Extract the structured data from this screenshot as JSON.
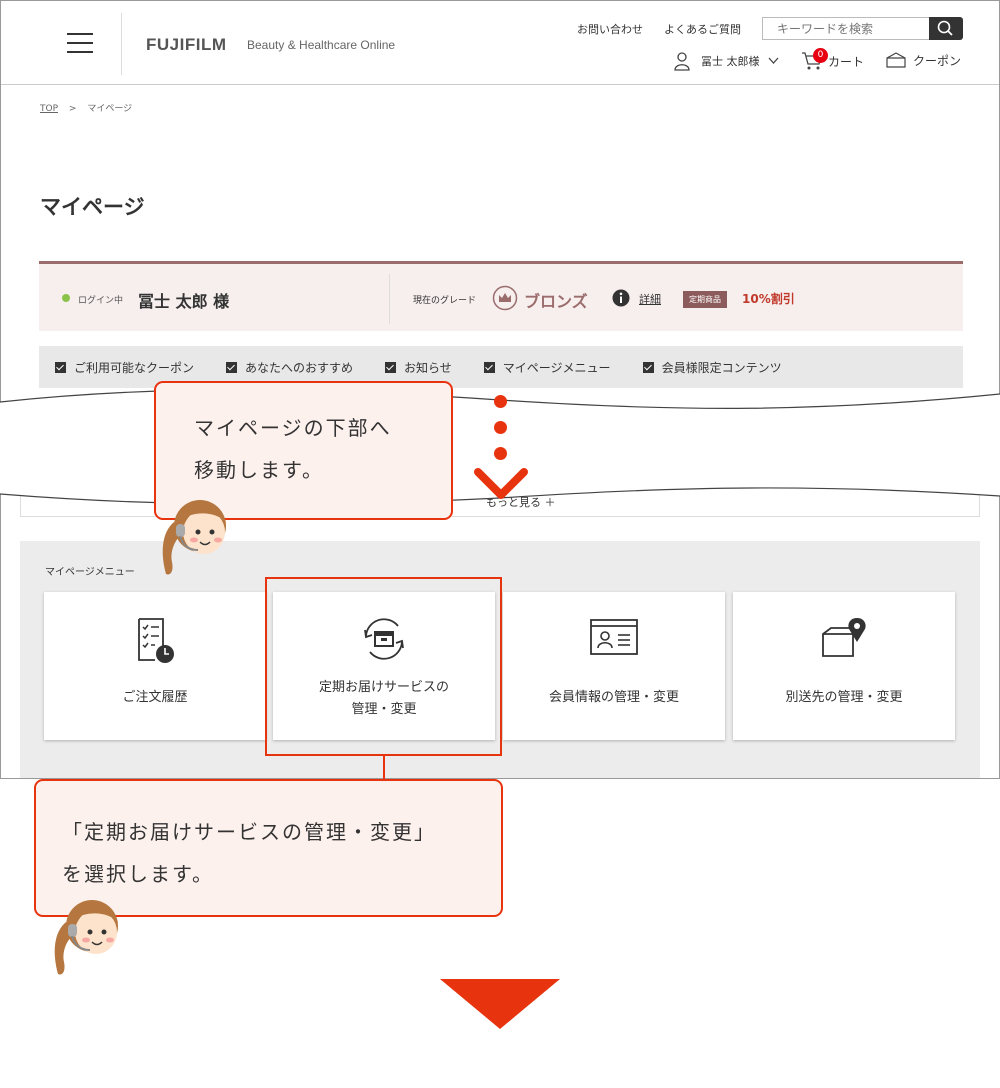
{
  "header": {
    "brand": "FUJIFILM",
    "brand_sub": "Beauty & Healthcare Online",
    "contact": "お問い合わせ",
    "faq": "よくあるご質問",
    "search_placeholder": "キーワードを検索",
    "user_label": "冨士 太郎様",
    "cart_label": "カート",
    "cart_count": "0",
    "coupon_label": "クーポン"
  },
  "breadcrumb": {
    "top": "TOP",
    "separator": ">",
    "current": "マイページ"
  },
  "page_title": "マイページ",
  "status": {
    "login_label": "ログイン中",
    "user_name": "冨士 太郎 様",
    "grade_label": "現在のグレード",
    "grade_value": "ブロンズ",
    "detail_link": "詳細",
    "product_badge": "定期商品",
    "discount": "10%割引"
  },
  "quick_nav": [
    {
      "label": "ご利用可能なクーポン"
    },
    {
      "label": "あなたへのおすすめ"
    },
    {
      "label": "お知らせ"
    },
    {
      "label": "マイページメニュー"
    },
    {
      "label": "会員様限定コンテンツ"
    }
  ],
  "more": {
    "label": "もっと見る ＋"
  },
  "mypage_menu": {
    "title": "マイページメニュー",
    "cards": [
      {
        "line1": "ご注文履歴",
        "line2": "",
        "icon": "order-history-icon"
      },
      {
        "line1": "定期お届けサービスの",
        "line2": "管理・変更",
        "icon": "subscription-icon"
      },
      {
        "line1": "会員情報の管理・変更",
        "line2": "",
        "icon": "member-card-icon"
      },
      {
        "line1": "別送先の管理・変更",
        "line2": "",
        "icon": "delivery-address-icon"
      }
    ]
  },
  "callouts": {
    "first": {
      "line1": "マイページの下部へ",
      "line2": "移動します。"
    },
    "second": {
      "line1": "「定期お届けサービスの管理・変更」",
      "line2": "を選択します。"
    }
  },
  "colors": {
    "accent": "#e8330f",
    "bubble_bg": "#fdf1ee",
    "brand_brown": "#9a6c6c",
    "discount_red": "#c0392b"
  }
}
